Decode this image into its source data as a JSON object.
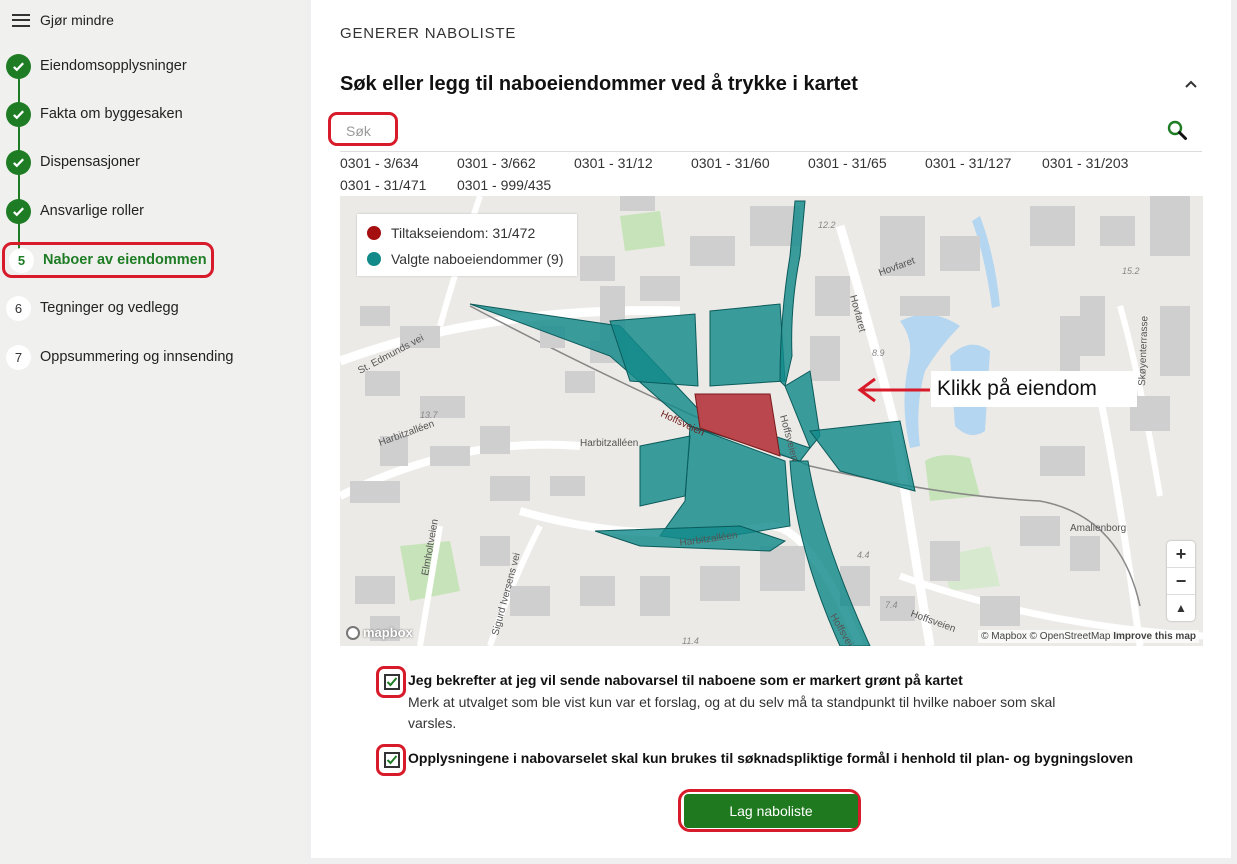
{
  "sidebar": {
    "collapse_label": "Gjør mindre",
    "steps": [
      {
        "label": "Eiendomsopplysninger",
        "status": "done"
      },
      {
        "label": "Fakta om byggesaken",
        "status": "done"
      },
      {
        "label": "Dispensasjoner",
        "status": "done"
      },
      {
        "label": "Ansvarlige roller",
        "status": "done"
      },
      {
        "number": "5",
        "label": "Naboer av eiendommen",
        "status": "active"
      },
      {
        "number": "6",
        "label": "Tegninger og vedlegg",
        "status": "todo"
      },
      {
        "number": "7",
        "label": "Oppsummering og innsending",
        "status": "todo"
      }
    ]
  },
  "main": {
    "section_title": "GENERER NABOLISTE",
    "heading": "Søk eller legg til naboeiendommer ved å trykke i kartet",
    "search": {
      "placeholder": "Søk",
      "value": ""
    },
    "properties": [
      "0301 - 3/634",
      "0301 - 3/662",
      "0301 - 31/12",
      "0301 - 31/60",
      "0301 - 31/65",
      "0301 - 31/127",
      "0301 - 31/203",
      "0301 - 31/471",
      "0301 - 999/435"
    ],
    "map": {
      "legend": [
        {
          "label": "Tiltakseiendom: 31/472",
          "color": "#a50f0f"
        },
        {
          "label": "Valgte naboeiendommer (9)",
          "color": "#128a8a"
        }
      ],
      "callout": "Klikk på eiendom",
      "street_labels": [
        "St. Edmunds vei",
        "Harbitzalléen",
        "Harbitzalléen",
        "Harbitzalléen",
        "Hoffsveien",
        "Hoffsveien",
        "Hoffsveien",
        "Hovfaret",
        "Hovfaret",
        "Skøyenterrasse",
        "Amalienborg",
        "Elmholtveien",
        "Sigurd Iversens vei",
        "Hoffsveien"
      ],
      "map_numbers": [
        "12.2",
        "8.9",
        "13.7",
        "15.2",
        "4.4",
        "7.4",
        "11.4"
      ],
      "zoom_in": "+",
      "zoom_out": "−",
      "compass": "▲",
      "logo": "mapbox",
      "attribution": "© Mapbox © OpenStreetMap",
      "improve": "Improve this map"
    },
    "confirm1": {
      "label": "Jeg bekrefter at jeg vil sende nabovarsel til naboene som er markert grønt på kartet",
      "note": "Merk at utvalget som ble vist kun var et forslag, og at du selv må ta standpunkt til hvilke naboer som skal varsles.",
      "checked": true
    },
    "confirm2": {
      "label": "Opplysningene i nabovarselet skal kun brukes til søknadspliktige formål i henhold til plan- og bygningsloven",
      "checked": true
    },
    "submit_label": "Lag naboliste"
  },
  "colors": {
    "accent_green": "#1e7d24",
    "highlight_red": "#d81b2a",
    "teal": "#128a8a",
    "red_property": "#a50f0f"
  }
}
